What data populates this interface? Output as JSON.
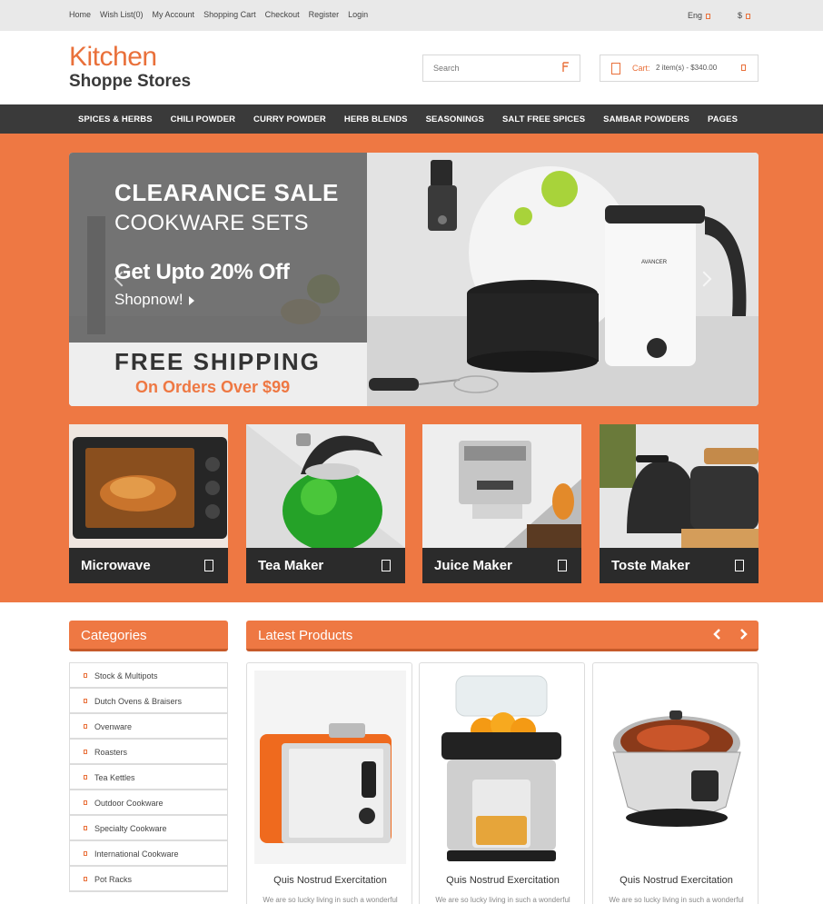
{
  "topbar": {
    "links": [
      "Home",
      "Wish List(0)",
      "My Account",
      "Shopping Cart",
      "Checkout",
      "Register",
      "Login"
    ],
    "language": "Eng",
    "currency": "$"
  },
  "header": {
    "logo_line1": "Kitchen",
    "logo_line2": "Shoppe Stores",
    "search_placeholder": "Search",
    "cart_label": "Cart:",
    "cart_summary": "2 item(s) - $340.00"
  },
  "nav": {
    "items": [
      "SPICES & HERBS",
      "CHILI POWDER",
      "CURRY POWDER",
      "HERB BLENDS",
      "SEASONINGS",
      "SALT FREE SPICES",
      "SAMBAR POWDERS",
      "PAGES"
    ]
  },
  "slider": {
    "line1": "CLEARANCE SALE",
    "line2": "COOKWARE SETS",
    "line3": "Get Upto 20% Off",
    "cta": "Shopnow!",
    "line5": "FREE SHIPPING",
    "line6": "On Orders Over $99",
    "brand_on_kettle": "AVANCER"
  },
  "categories_tiles": [
    {
      "name": "Microwave",
      "icon": "bag-icon"
    },
    {
      "name": "Tea Maker",
      "icon": "bag-icon"
    },
    {
      "name": "Juice Maker",
      "icon": "bag-icon"
    },
    {
      "name": "Toste Maker",
      "icon": "bag-icon"
    }
  ],
  "sidebar": {
    "title": "Categories",
    "items": [
      "Stock & Multipots",
      "Dutch Ovens & Braisers",
      "Ovenware",
      "Roasters",
      "Tea Kettles",
      "Outdoor Cookware",
      "Specialty Cookware",
      "International Cookware",
      "Pot Racks"
    ]
  },
  "latest": {
    "title": "Latest Products",
    "products": [
      {
        "name": "Quis Nostrud Exercitation",
        "desc": "We are so lucky living in such a wonderful"
      },
      {
        "name": "Quis Nostrud Exercitation",
        "desc": "We are so lucky living in such a wonderful"
      },
      {
        "name": "Quis Nostrud Exercitation",
        "desc": "We are so lucky living in such a wonderful"
      }
    ]
  },
  "colors": {
    "accent": "#ee7843",
    "dark": "#3a3a3a",
    "topbar": "#e9e9e9"
  }
}
